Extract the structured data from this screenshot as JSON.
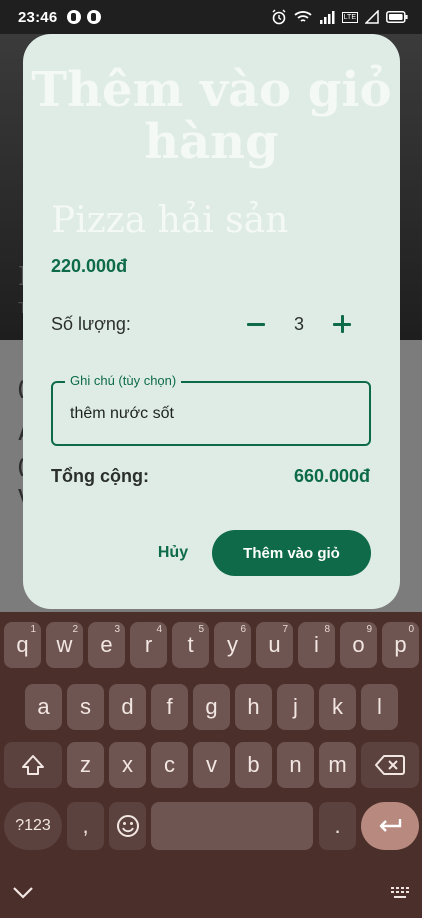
{
  "status_bar": {
    "time": "23:46",
    "network_badge": "LTE"
  },
  "background_app": {
    "hero_letter": "P",
    "hero_sub": "T",
    "rows": [
      "(",
      "A",
      "(",
      "V"
    ]
  },
  "dialog": {
    "title": "Thêm vào giỏ hàng",
    "product_name": "Pizza hải sản",
    "unit_price": "220.000đ",
    "quantity_label": "Số lượng:",
    "quantity": "3",
    "note_label": "Ghi chú (tùy chọn)",
    "note_value": "thêm nước sốt",
    "total_label": "Tổng cộng:",
    "total_value": "660.000đ",
    "cancel_label": "Hủy",
    "confirm_label": "Thêm vào giỏ"
  },
  "keyboard": {
    "row1": [
      {
        "key": "q",
        "hint": "1"
      },
      {
        "key": "w",
        "hint": "2"
      },
      {
        "key": "e",
        "hint": "3"
      },
      {
        "key": "r",
        "hint": "4"
      },
      {
        "key": "t",
        "hint": "5"
      },
      {
        "key": "y",
        "hint": "6"
      },
      {
        "key": "u",
        "hint": "7"
      },
      {
        "key": "i",
        "hint": "8"
      },
      {
        "key": "o",
        "hint": "9"
      },
      {
        "key": "p",
        "hint": "0"
      }
    ],
    "row2": [
      "a",
      "s",
      "d",
      "f",
      "g",
      "h",
      "j",
      "k",
      "l"
    ],
    "row3": [
      "z",
      "x",
      "c",
      "v",
      "b",
      "n",
      "m"
    ],
    "symbols_label": "?123",
    "comma": ",",
    "period": ".",
    "icons": {
      "shift": "shift-icon",
      "backspace": "backspace-icon",
      "emoji": "emoji-icon",
      "enter": "enter-icon",
      "hide": "chevron-down-icon",
      "switch": "keyboard-switch-icon"
    }
  },
  "colors": {
    "accent": "#0d6b4a",
    "dialog_bg": "#dfece6",
    "keyboard_bg": "#4a2f2a"
  }
}
